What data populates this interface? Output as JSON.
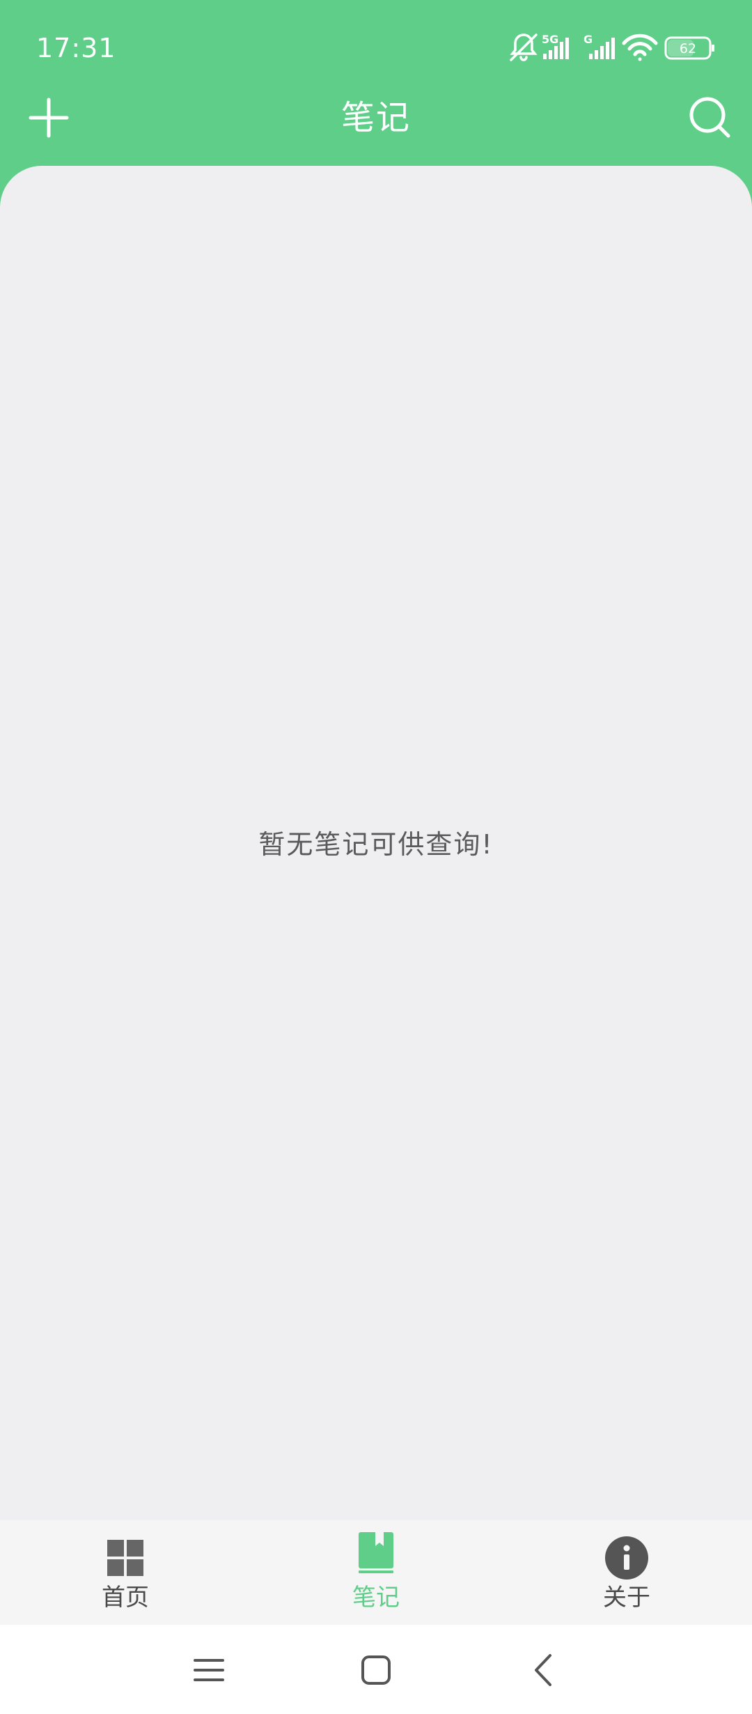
{
  "status_bar": {
    "time": "17:31",
    "network_1": "5G",
    "network_2": "G",
    "battery": "62",
    "icons": [
      "bell-muted-icon",
      "signal-5g-icon",
      "signal-g-icon",
      "wifi-icon",
      "battery-icon"
    ]
  },
  "header": {
    "title": "笔记",
    "add_icon": "plus-icon",
    "search_icon": "search-icon"
  },
  "main": {
    "empty_message": "暂无笔记可供查询!"
  },
  "bottom_nav": {
    "items": [
      {
        "label": "首页",
        "icon": "grid-icon",
        "active": false
      },
      {
        "label": "笔记",
        "icon": "notebook-icon",
        "active": true
      },
      {
        "label": "关于",
        "icon": "info-icon",
        "active": false
      }
    ]
  },
  "system_nav": {
    "icons": [
      "menu-icon",
      "home-icon",
      "back-icon"
    ]
  },
  "colors": {
    "accent": "#5fce89",
    "background": "#efeff1",
    "nav_background": "#f5f5f5",
    "icon_gray": "#666666"
  }
}
